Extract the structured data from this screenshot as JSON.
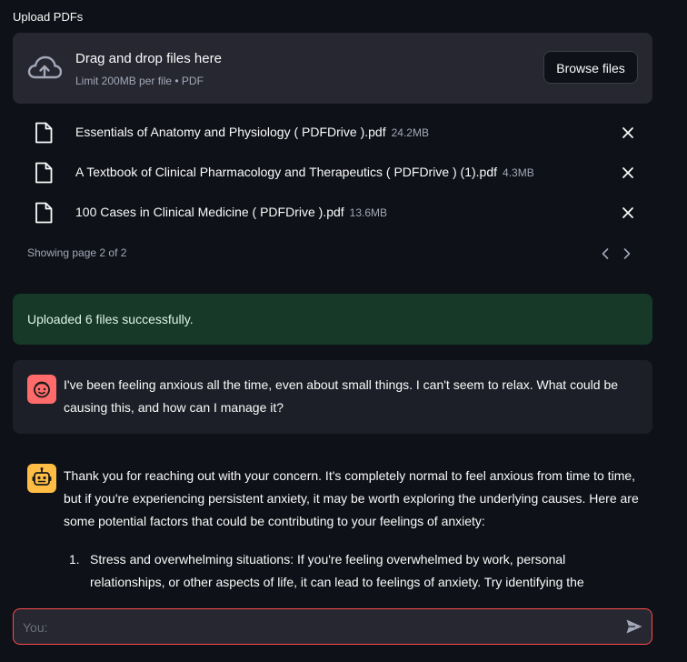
{
  "uploader": {
    "label": "Upload PDFs",
    "dropzone_title": "Drag and drop files here",
    "dropzone_subtitle": "Limit 200MB per file • PDF",
    "browse_label": "Browse files",
    "files": [
      {
        "name": "Essentials of Anatomy and Physiology ( PDFDrive ).pdf",
        "size": "24.2MB"
      },
      {
        "name": "A Textbook of Clinical Pharmacology and Therapeutics ( PDFDrive ) (1).pdf",
        "size": "4.3MB"
      },
      {
        "name": "100 Cases in Clinical Medicine ( PDFDrive ).pdf",
        "size": "13.6MB"
      }
    ],
    "pager_text": "Showing page 2 of 2",
    "icons": {
      "upload": "cloud-upload-icon",
      "file": "file-icon",
      "remove": "close-icon",
      "prev": "chevron-left-icon",
      "next": "chevron-right-icon"
    }
  },
  "status": {
    "success_message": "Uploaded 6 files successfully.",
    "success_color": "#173928"
  },
  "chat": {
    "messages": [
      {
        "role": "user",
        "avatar": "user-face-icon",
        "avatar_color": "#ff6b6b",
        "text": "I've been feeling anxious all the time, even about small things. I can't seem to relax. What could be causing this, and how can I manage it?"
      },
      {
        "role": "assistant",
        "avatar": "robot-icon",
        "avatar_color": "#ffbd45",
        "text": "Thank you for reaching out with your concern. It's completely normal to feel anxious from time to time, but if you're experiencing persistent anxiety, it may be worth exploring the underlying causes. Here are some potential factors that could be contributing to your feelings of anxiety:",
        "list": [
          {
            "number": "1.",
            "text": "Stress and overwhelming situations: If you're feeling overwhelmed by work, personal relationships, or other aspects of life, it can lead to feelings of anxiety. Try identifying the"
          }
        ]
      }
    ],
    "input_placeholder": "You:",
    "input_value": "",
    "accent_color": "#ff4b4b",
    "send_icon": "send-icon"
  }
}
